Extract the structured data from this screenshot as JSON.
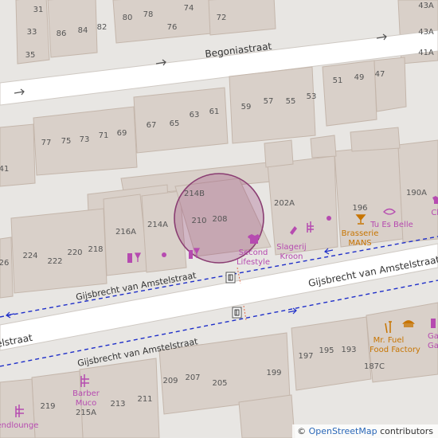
{
  "map": {
    "streets": {
      "begonia": "Begoniastraat",
      "gijsbrecht_main": "Gijsbrecht van Amstelstraat",
      "gijsbrecht_north": "Gijsbrecht van Amstelstraat",
      "gijsbrecht_south": "Gijsbrecht van Amstelstraat",
      "gijsbrecht_left_cut": "elstraat"
    },
    "house_numbers": {
      "n31": "31",
      "n33": "33",
      "n35": "35",
      "n86": "86",
      "n84": "84",
      "n82": "82",
      "n80": "80",
      "n78": "78",
      "n76": "76",
      "n74": "74",
      "n72": "72",
      "n43a_top": "43A",
      "n43a": "43A",
      "n41a": "41A",
      "n51": "51",
      "n49": "49",
      "n47": "47",
      "n59": "59",
      "n57": "57",
      "n55": "55",
      "n53": "53",
      "n67": "67",
      "n65": "65",
      "n63": "63",
      "n61": "61",
      "n77": "77",
      "n75": "75",
      "n73": "73",
      "n71": "71",
      "n69": "69",
      "n41": "41",
      "n214b": "214B",
      "n210": "210",
      "n208": "208",
      "n214a": "214A",
      "n216a": "216A",
      "n202a": "202A",
      "n196": "196",
      "n190a": "190A",
      "n224": "224",
      "n222": "222",
      "n220": "220",
      "n218": "218",
      "n26": "26",
      "n197": "197",
      "n195": "195",
      "n193": "193",
      "n187c": "187C",
      "n199": "199",
      "n209": "209",
      "n207": "207",
      "n205": "205",
      "n213": "213",
      "n211": "211",
      "n219": "219",
      "n215a": "215A"
    },
    "pois": {
      "second_lifestyle": "Second Lifestyle",
      "slagerij_kroon": "Slagerij Kroon",
      "brasserie_mans": "Brasserie MANS",
      "tu_es_belle": "Tu Es Belle",
      "mr_fuel": "Mr. Fuel Food Factory",
      "barber_muco": "Barber Muco",
      "cut_ga": "Ga",
      "cut_ga2": "Ga",
      "cut_ch": "Ch",
      "cut_lounge": "rendlounge"
    },
    "icons": [
      "tram-stop-icon",
      "bus-stop-icon",
      "clothes-icon",
      "butcher-icon",
      "bar-icon",
      "beauty-icon",
      "fast-food-icon",
      "burger-icon",
      "hairdresser-icon",
      "wine-icon",
      "gift-icon",
      "alcohol-shop-icon"
    ],
    "colors": {
      "building": "#d9d0c9",
      "road": "#ffffff",
      "background": "#e8e6e3",
      "bus_route": "#1f2fc9",
      "poi_shop": "#b64bb0",
      "poi_food": "#c77400",
      "highlight": "#8a3d72"
    }
  },
  "attribution": {
    "prefix": "©",
    "link": "OpenStreetMap",
    "suffix": "contributors"
  }
}
